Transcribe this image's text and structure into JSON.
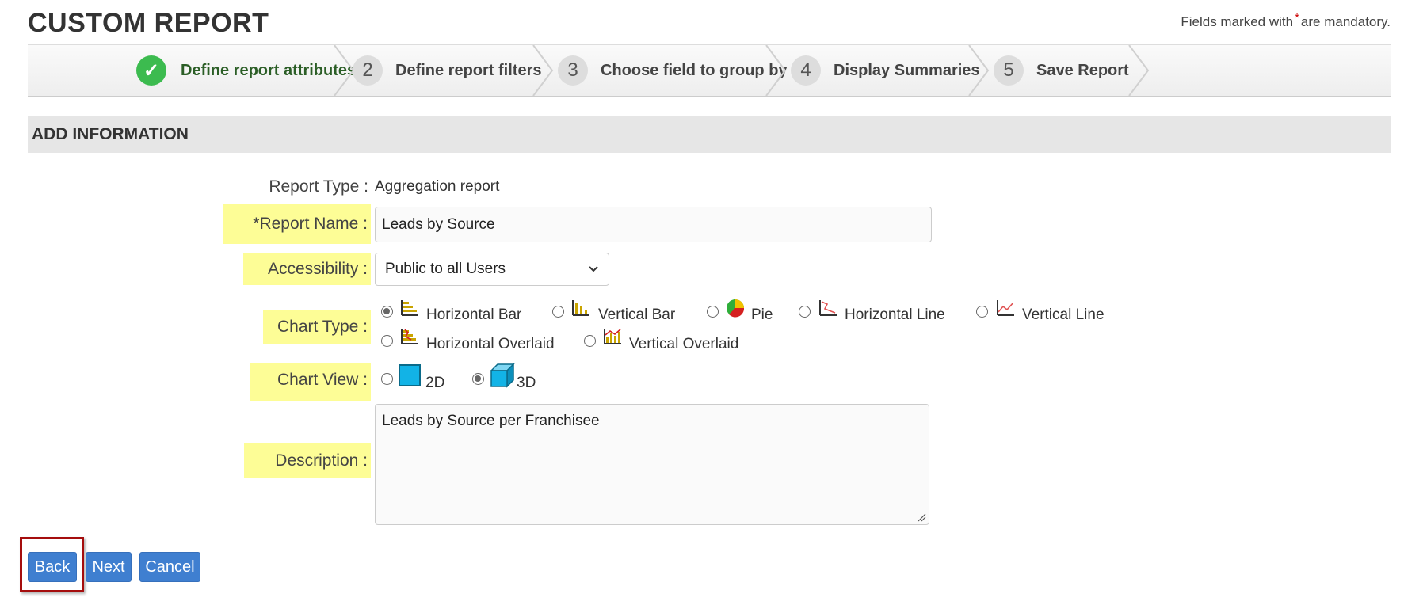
{
  "page": {
    "title": "CUSTOM REPORT",
    "mandatory_prefix": "Fields marked with",
    "mandatory_star": "*",
    "mandatory_suffix": "are mandatory."
  },
  "wizard": {
    "steps": [
      {
        "number": "",
        "label": "Define report attributes",
        "state": "completed"
      },
      {
        "number": "2",
        "label": "Define report filters",
        "state": "pending"
      },
      {
        "number": "3",
        "label": "Choose field to group by",
        "state": "pending"
      },
      {
        "number": "4",
        "label": "Display Summaries",
        "state": "pending"
      },
      {
        "number": "5",
        "label": "Save Report",
        "state": "pending"
      }
    ]
  },
  "section": {
    "title": "ADD INFORMATION"
  },
  "form": {
    "report_type": {
      "label": "Report Type :",
      "value": "Aggregation report"
    },
    "report_name": {
      "label": "*Report Name :",
      "value": "Leads by Source"
    },
    "accessibility": {
      "label": "Accessibility :",
      "selected": "Public to all Users"
    },
    "chart_type": {
      "label": "Chart Type :",
      "options": [
        {
          "label": "Horizontal Bar",
          "icon": "horizontal-bar-chart-icon",
          "selected": true
        },
        {
          "label": "Vertical Bar",
          "icon": "vertical-bar-chart-icon",
          "selected": false
        },
        {
          "label": "Pie",
          "icon": "pie-chart-icon",
          "selected": false
        },
        {
          "label": "Horizontal Line",
          "icon": "horizontal-line-chart-icon",
          "selected": false
        },
        {
          "label": "Vertical Line",
          "icon": "vertical-line-chart-icon",
          "selected": false
        },
        {
          "label": "Horizontal Overlaid",
          "icon": "horizontal-overlaid-chart-icon",
          "selected": false
        },
        {
          "label": "Vertical Overlaid",
          "icon": "vertical-overlaid-chart-icon",
          "selected": false
        }
      ]
    },
    "chart_view": {
      "label": "Chart View :",
      "options": [
        {
          "label": "2D",
          "icon": "square-2d-icon",
          "selected": false
        },
        {
          "label": "3D",
          "icon": "cube-3d-icon",
          "selected": true
        }
      ]
    },
    "description": {
      "label": "Description :",
      "value": "Leads by Source per Franchisee"
    }
  },
  "buttons": {
    "back": "Back",
    "next": "Next",
    "cancel": "Cancel"
  },
  "colors": {
    "highlight": "#fdfd96",
    "button": "#3f7fd0",
    "step_done": "#3cbb4f",
    "annotation_box": "#a50d0d"
  }
}
